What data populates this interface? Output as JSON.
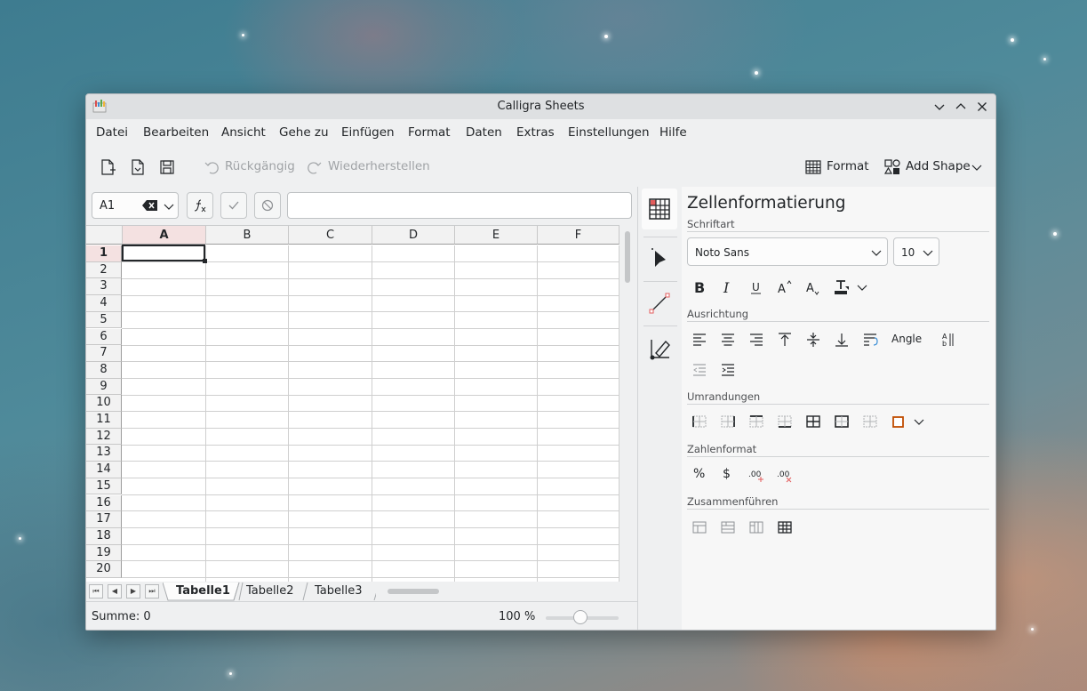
{
  "window": {
    "title": "Calligra Sheets"
  },
  "menu": [
    "Datei",
    "Bearbeiten",
    "Ansicht",
    "Gehe zu",
    "Einfügen",
    "Format",
    "Daten",
    "Extras",
    "Einstellungen",
    "Hilfe"
  ],
  "toolbar": {
    "undo": "Rückgängig",
    "redo": "Wiederherstellen",
    "format": "Format",
    "add_shape": "Add Shape"
  },
  "formula_bar": {
    "cell_ref": "A1",
    "formula": ""
  },
  "grid": {
    "columns": [
      "A",
      "B",
      "C",
      "D",
      "E",
      "F"
    ],
    "rows": [
      "1",
      "2",
      "3",
      "4",
      "5",
      "6",
      "7",
      "8",
      "9",
      "10",
      "11",
      "12",
      "13",
      "14",
      "15",
      "16",
      "17",
      "18",
      "19",
      "20"
    ],
    "active_cell": "A1"
  },
  "sheets": [
    "Tabelle1",
    "Tabelle2",
    "Tabelle3"
  ],
  "status": {
    "sum": "Summe: 0",
    "zoom": "100 %",
    "zoom_level": 100
  },
  "docker": {
    "title": "Zellenformatierung",
    "font_section": "Schriftart",
    "font_family": "Noto Sans",
    "font_size": "10",
    "align_section": "Ausrichtung",
    "angle_label": "Angle",
    "border_section": "Umrandungen",
    "number_section": "Zahlenformat",
    "percent": "%",
    "currency": "$",
    "merge_section": "Zusammenführen"
  },
  "colors": {
    "accent": "#e35d5d",
    "border_icon": "#c04c00",
    "active_header": "#f4e1e1"
  }
}
